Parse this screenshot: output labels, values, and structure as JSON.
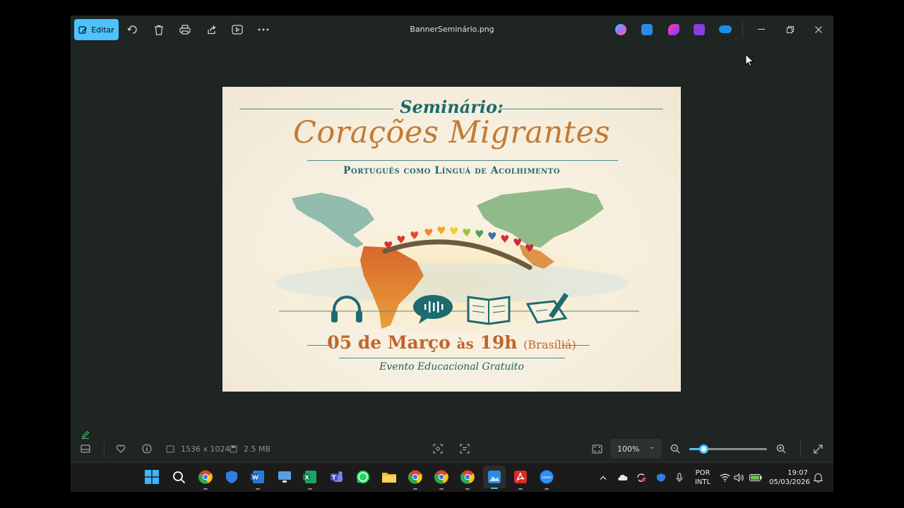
{
  "window": {
    "title": "BannerSeminário.png",
    "edit_label": "Editar"
  },
  "banner": {
    "seminario": "Seminário:",
    "title": "Corações Migrantes",
    "subtitle": "Português como Línguá de Acolhimento",
    "date_day": "05 de Março",
    "date_as": "às",
    "date_time": "19h",
    "date_tz": "(Brasíliá)",
    "event": "Evento Educacional Gratuito"
  },
  "bottombar": {
    "dimensions": "1536 x 1024",
    "filesize": "2.5 MB",
    "zoom": "100%",
    "zoom_fraction": 0.18
  },
  "taskbar": {
    "lang_top": "POR",
    "lang_bottom": "INTL",
    "time": "19:07",
    "date": "05/03/2026"
  },
  "colors": {
    "accent": "#4cc2ff",
    "window_bg": "#1f2523",
    "banner_teal": "#1d6b6e",
    "banner_orange": "#c37a32"
  }
}
